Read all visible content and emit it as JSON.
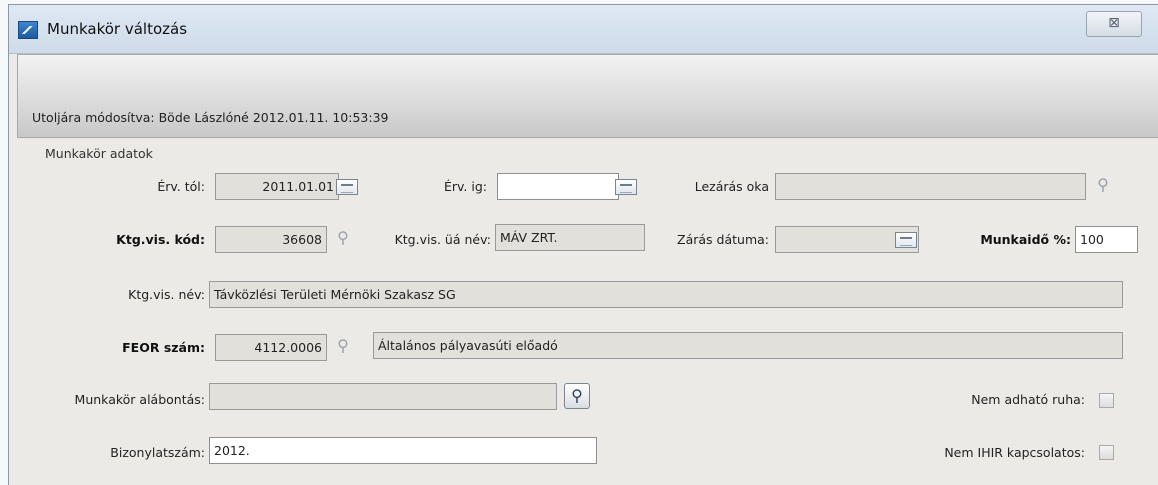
{
  "window": {
    "title": "Munkakör változás",
    "close_symbol": "⊠"
  },
  "info": {
    "last_modified": "Utoljára módosítva: Böde Lászlóné 2012.01.11. 10:53:39"
  },
  "section": {
    "title": "Munkakör adatok"
  },
  "fields": {
    "erv_tol": {
      "label": "Érv. tól:",
      "value": "2011.01.01"
    },
    "erv_ig": {
      "label": "Érv. ig:",
      "value": ""
    },
    "lezaras_oka": {
      "label": "Lezárás oka",
      "value": ""
    },
    "ktg_vis_kod": {
      "label": "Ktg.vis. kód:",
      "value": "36608"
    },
    "ktg_vis_ua_nev": {
      "label": "Ktg.vis. üá név:",
      "value": "MÁV ZRT."
    },
    "zaras_datuma": {
      "label": "Zárás dátuma:",
      "value": ""
    },
    "munkaido": {
      "label": "Munkaidő %:",
      "value": "100"
    },
    "ktg_vis_nev": {
      "label": "Ktg.vis. név:",
      "value": "Távközlési Területi Mérnöki Szakasz SG"
    },
    "feor_szam": {
      "label": "FEOR szám:",
      "value": "4112.0006",
      "description": "Általános pályavasúti előadó"
    },
    "munkakor_alabontas": {
      "label": "Munkakör alábontás:",
      "value": ""
    },
    "bizonylatszam": {
      "label": "Bizonylatszám:",
      "value": "2012."
    },
    "nem_adhato_ruha": {
      "label": "Nem adható ruha:",
      "checked": false
    },
    "nem_ihir_kapcsolatos": {
      "label": "Nem IHIR kapcsolatos:",
      "checked": false
    }
  },
  "icons": {
    "app": "app-window-icon",
    "calendar": "calendar-icon",
    "lookup": "magnifier-icon",
    "lookup_glyph": "⚲"
  }
}
